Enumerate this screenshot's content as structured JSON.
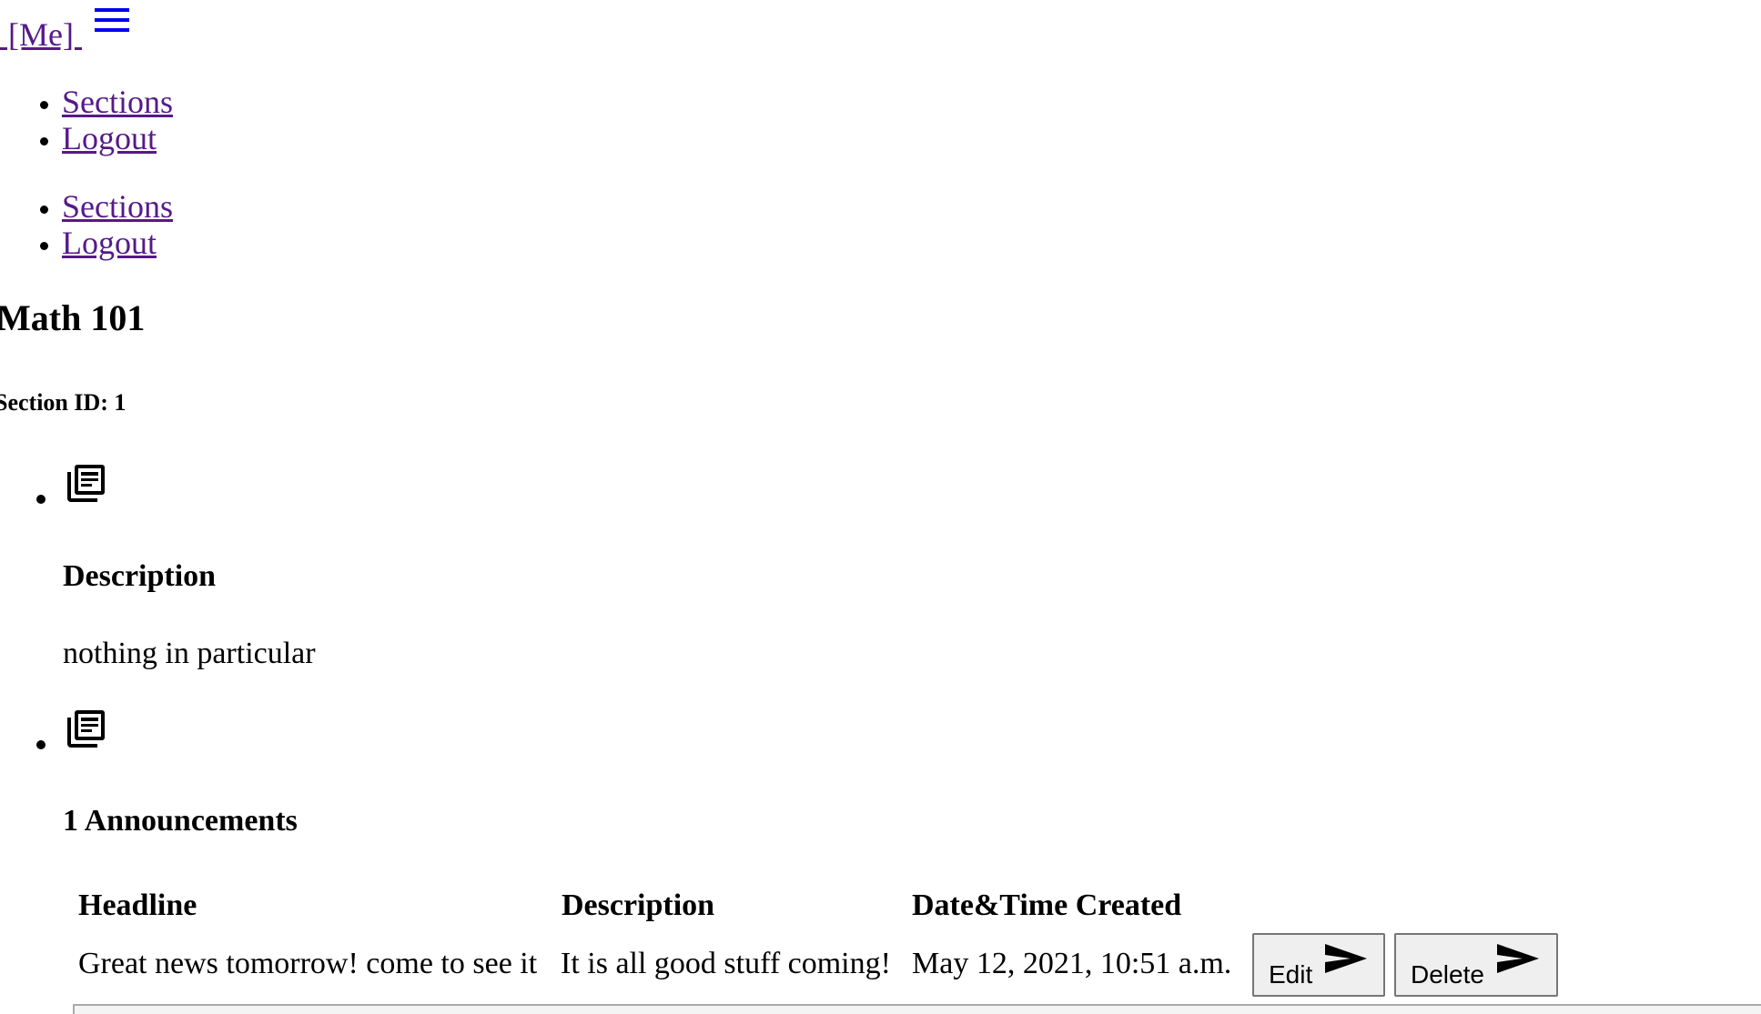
{
  "header": {
    "brand_label": " [Me] "
  },
  "nav_primary": [
    {
      "label": "Sections"
    },
    {
      "label": "Logout"
    }
  ],
  "nav_secondary": [
    {
      "label": "Sections"
    },
    {
      "label": "Logout"
    }
  ],
  "course": {
    "title": "Math 101",
    "section_id": "Section ID: 1"
  },
  "description_block": {
    "icon": "news-icon",
    "heading": "Description",
    "text": "nothing in particular"
  },
  "announcements_block": {
    "icon": "news-icon",
    "heading": "1 Announcements",
    "columns": [
      "Headline",
      "Description",
      "Date&Time Created"
    ],
    "rows": [
      {
        "headline": "Great news tomorrow! come to see it",
        "description": "It is all good stuff coming!",
        "created": "May 12, 2021, 10:51 a.m.",
        "edit_label": "Edit",
        "delete_label": "Delete"
      }
    ]
  },
  "colors": {
    "link": "#551a8b",
    "menu_icon": "#0000ee",
    "button_bg": "#efefef",
    "button_border": "#767676"
  }
}
